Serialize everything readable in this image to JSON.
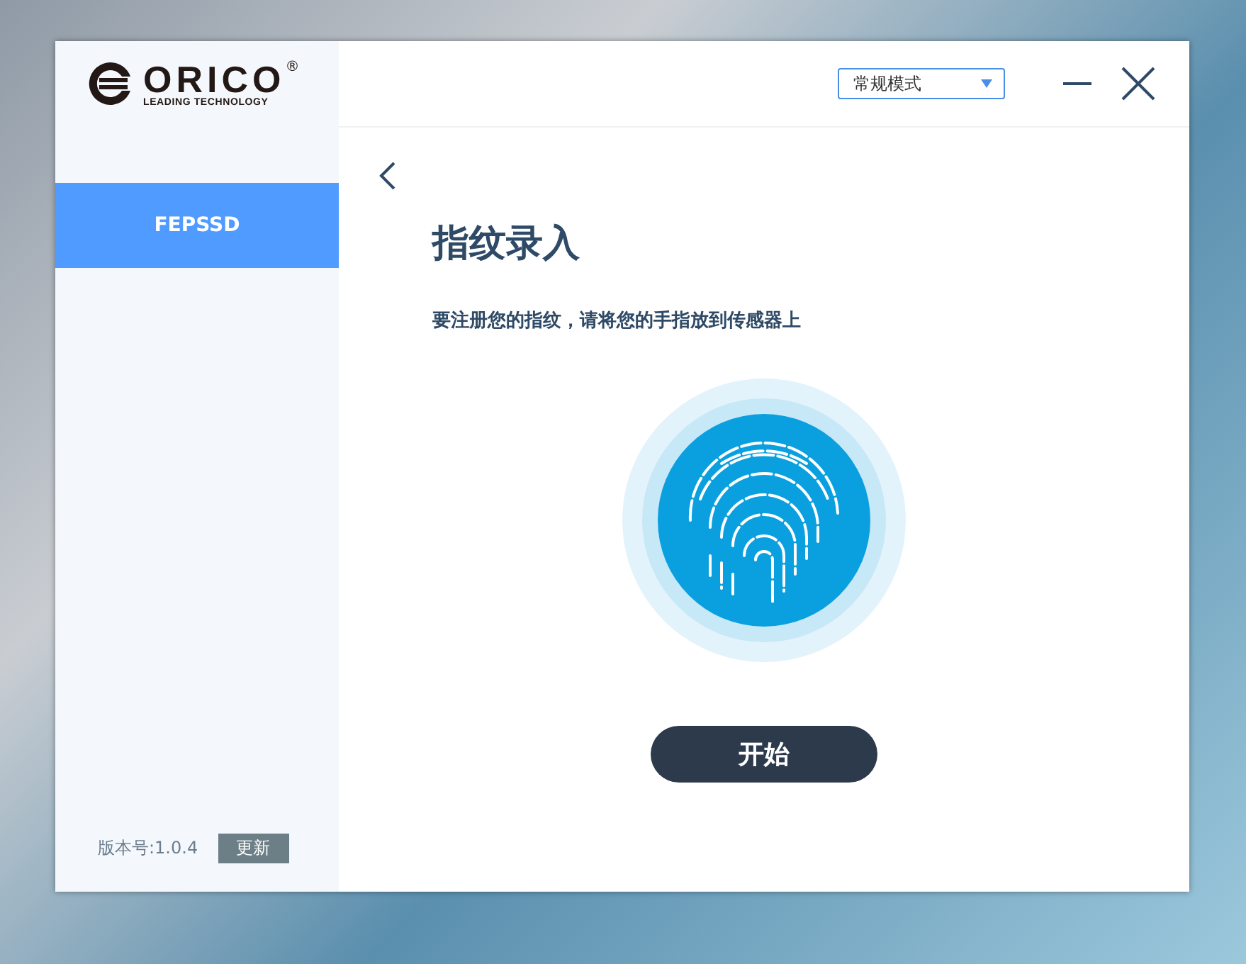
{
  "logo": {
    "name": "ORICO",
    "mark": "®",
    "tagline": "LEADING TECHNOLOGY"
  },
  "mode_select": {
    "value": "常规模式"
  },
  "sidebar": {
    "items": [
      {
        "label": "FEPSSD",
        "selected": true
      }
    ]
  },
  "version": {
    "label": "版本号:1.0.4",
    "update_button": "更新"
  },
  "page": {
    "title": "指纹录入",
    "instruction": "要注册您的指纹，请将您的手指放到传感器上",
    "start_button": "开始"
  }
}
